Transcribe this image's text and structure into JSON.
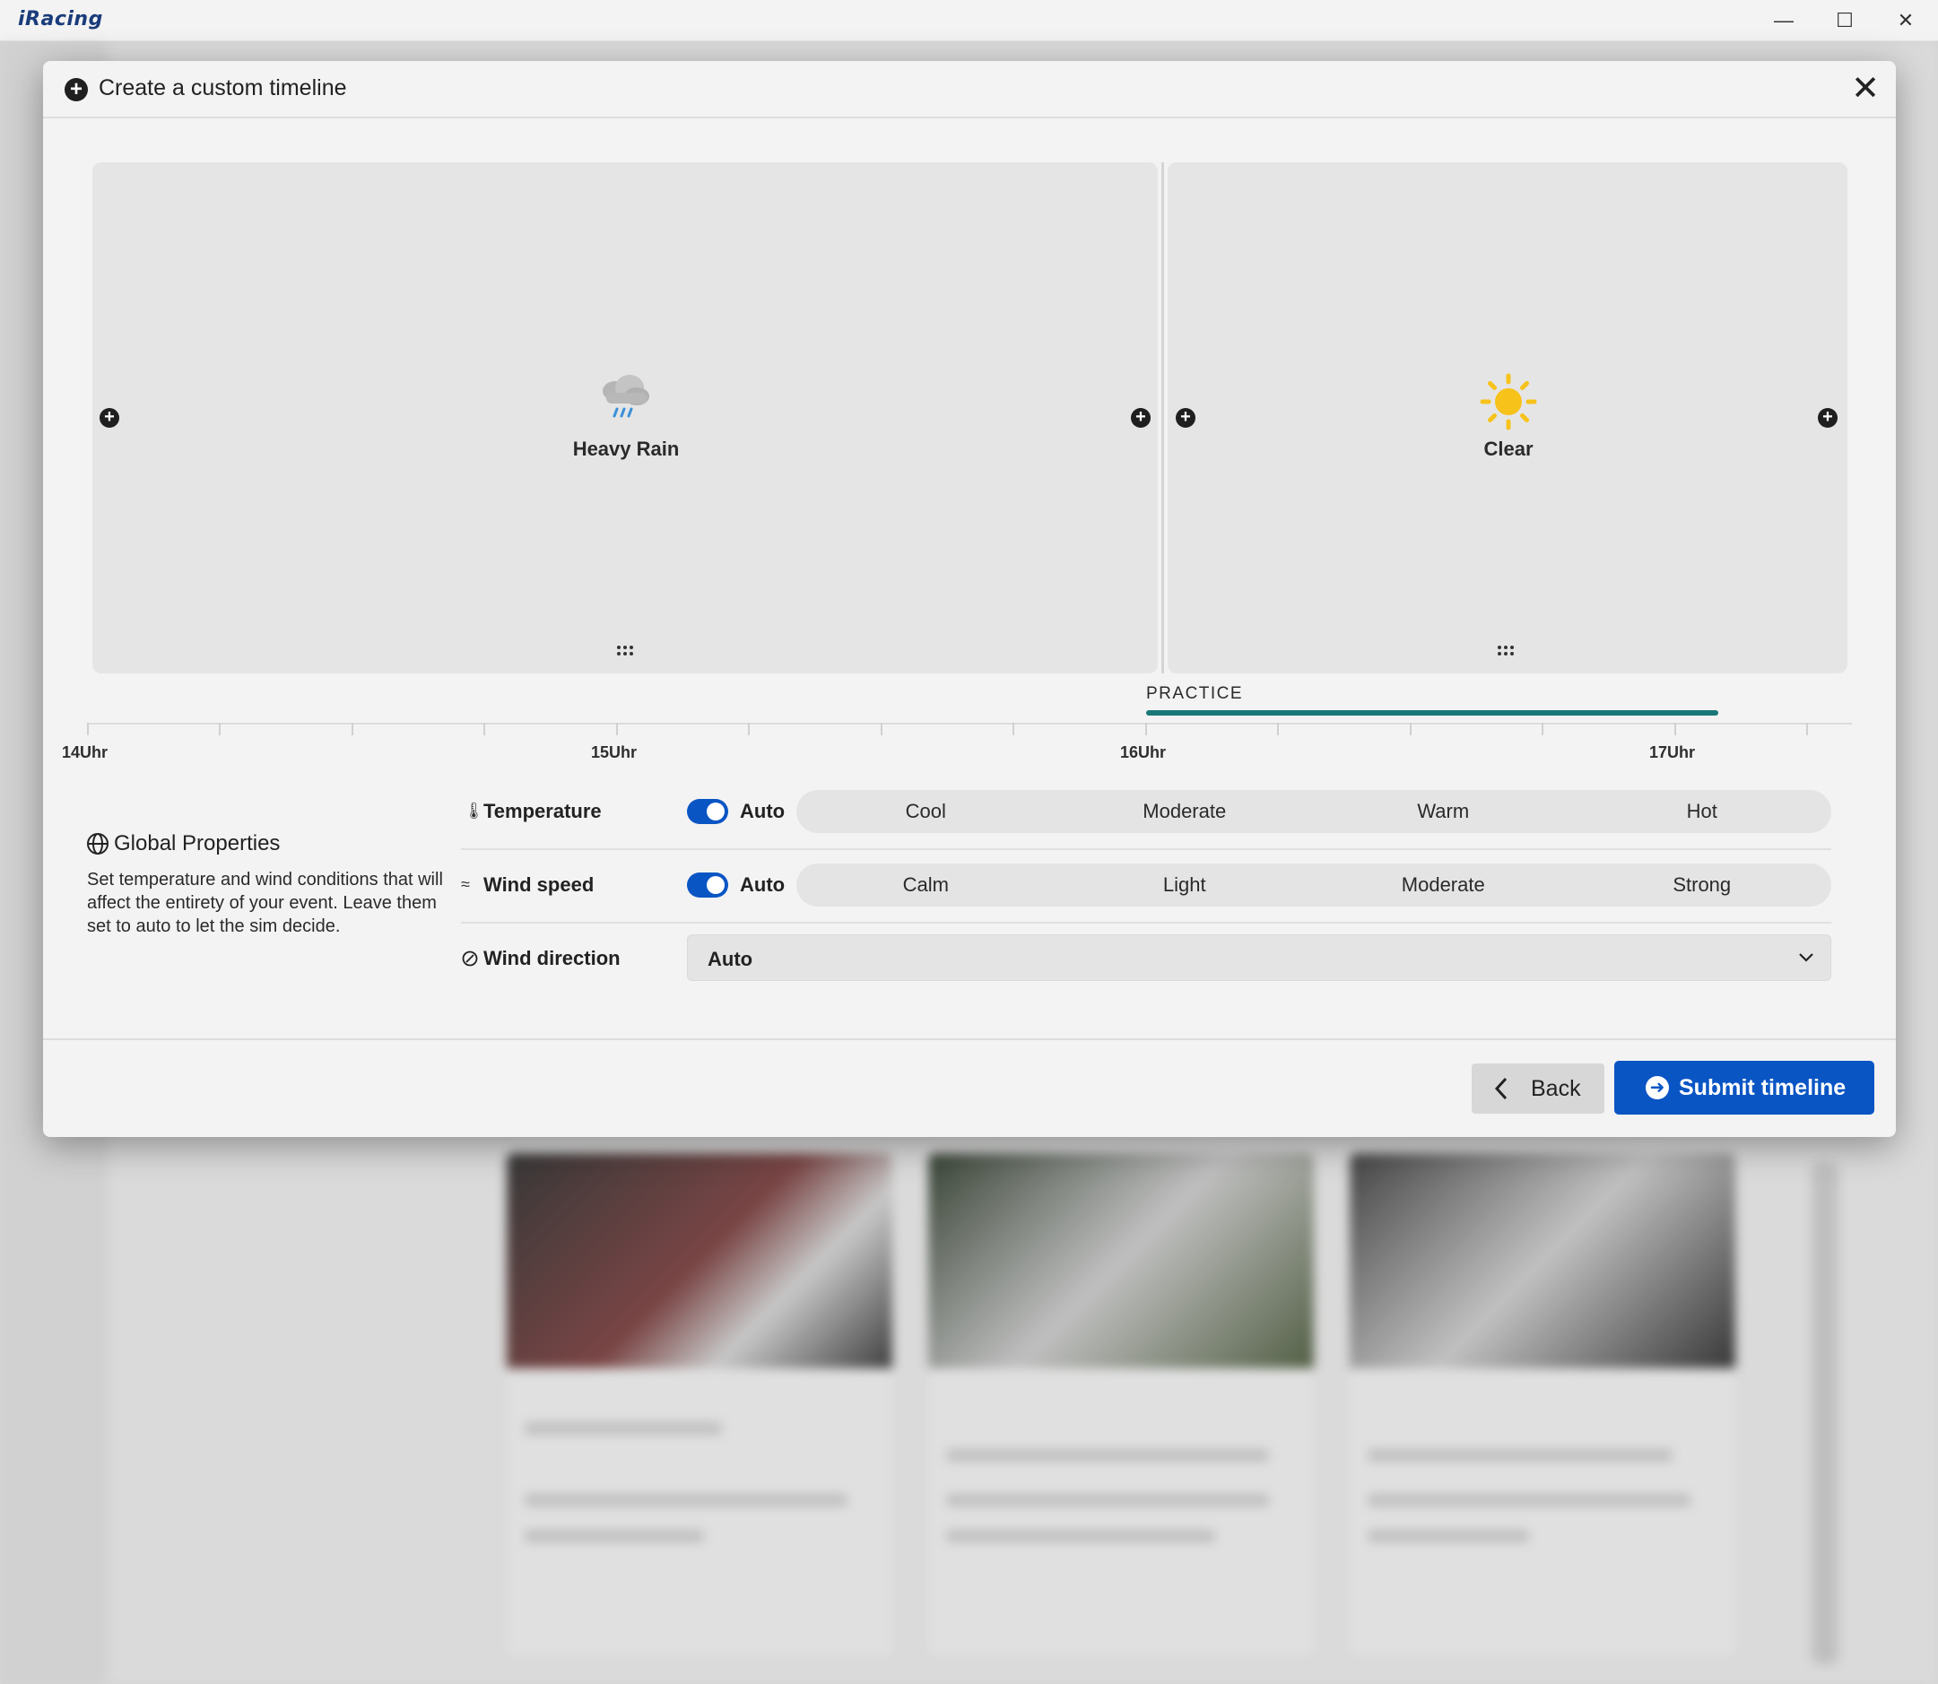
{
  "app": {
    "logo": "iRacing",
    "window_controls": {
      "minimize": "—",
      "maximize": "☐",
      "close": "✕"
    }
  },
  "modal": {
    "title": "Create a custom timeline",
    "close_glyph": "✕",
    "timeline": {
      "segments": [
        {
          "condition": "Heavy Rain",
          "icon": "heavy-rain-icon"
        },
        {
          "condition": "Clear",
          "icon": "sun-icon"
        }
      ],
      "session_label": "PRACTICE",
      "axis_labels": [
        "14Uhr",
        "15Uhr",
        "16Uhr",
        "17Uhr"
      ]
    },
    "global_properties": {
      "title": "Global Properties",
      "description": "Set temperature and wind conditions that will affect the entirety of your event. Leave them set to auto to let the sim decide.",
      "temperature": {
        "label": "Temperature",
        "auto_label": "Auto",
        "auto_enabled": true,
        "options": [
          "Cool",
          "Moderate",
          "Warm",
          "Hot"
        ]
      },
      "wind_speed": {
        "label": "Wind speed",
        "auto_label": "Auto",
        "auto_enabled": true,
        "options": [
          "Calm",
          "Light",
          "Moderate",
          "Strong"
        ]
      },
      "wind_direction": {
        "label": "Wind direction",
        "selected": "Auto"
      }
    },
    "footer": {
      "back_label": "Back",
      "submit_label": "Submit timeline"
    }
  },
  "colors": {
    "accent_blue": "#0a55c4",
    "practice_bar": "#1a7777",
    "sun": "#f7c21a",
    "rain_drops": "#3a8fd8"
  }
}
